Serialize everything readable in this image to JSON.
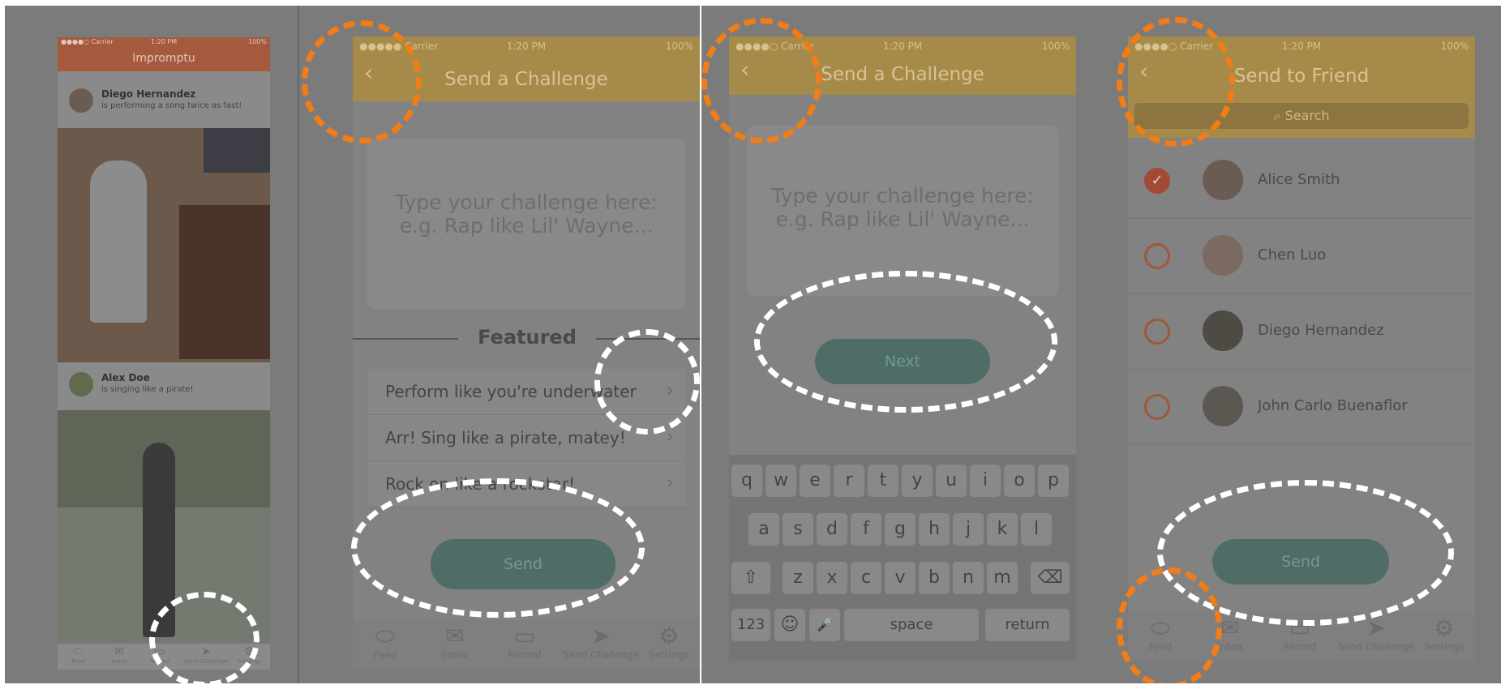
{
  "colors": {
    "ring_orange": "#f07d17",
    "ring_white": "#ffffff",
    "overlay_gray": "#7b7b7b",
    "accent_yellow": "#a58a4a",
    "accent_red": "#a14a34",
    "accent_teal": "#4f6d66"
  },
  "screen1": {
    "status": {
      "left": "●●●●○ Carrier",
      "center": "1:20 PM",
      "right": "100%"
    },
    "title": "Impromptu",
    "posts": [
      {
        "name": "Diego Hernandez",
        "caption": "is performing a song twice as fast!"
      },
      {
        "name": "Alex Doe",
        "caption": "is singing like a pirate!"
      }
    ],
    "tabs": [
      "Feed",
      "Inbox",
      "Record",
      "Send Challenge",
      "Settings"
    ]
  },
  "screen2": {
    "status": {
      "left": "●●●●● Carrier",
      "center": "1:20 PM",
      "right": "100%"
    },
    "back_icon": "‹",
    "title": "Send a Challenge",
    "placeholder_line1": "Type your challenge here:",
    "placeholder_line2": "e.g. Rap like Lil' Wayne...",
    "featured_label": "Featured",
    "featured": [
      "Perform like you're underwater",
      "Arr! Sing like a pirate, matey!",
      "Rock on like a rockstar!"
    ],
    "button": "Send",
    "tabs": [
      "Feed",
      "Inbox",
      "Record",
      "Send Challenge",
      "Settings"
    ]
  },
  "screen3": {
    "status": {
      "left": "●●●●○ Carrier",
      "center": "1:20 PM",
      "right": "100%"
    },
    "back_icon": "‹",
    "title": "Send a Challenge",
    "placeholder_line1": "Type your challenge here:",
    "placeholder_line2": "e.g. Rap like Lil' Wayne...",
    "button": "Next",
    "keys_row1": [
      "q",
      "w",
      "e",
      "r",
      "t",
      "y",
      "u",
      "i",
      "o",
      "p"
    ],
    "keys_row2": [
      "a",
      "s",
      "d",
      "f",
      "g",
      "h",
      "j",
      "k",
      "l"
    ],
    "keys_row3": [
      "z",
      "x",
      "c",
      "v",
      "b",
      "n",
      "m"
    ],
    "key_shift": "⇧",
    "key_delete": "⌫",
    "key_123": "123",
    "key_emoji": "☺",
    "key_mic": "🎤",
    "key_space": "space",
    "key_return": "return"
  },
  "screen4": {
    "status": {
      "left": "●●●●○ Carrier",
      "center": "1:20 PM",
      "right": "100%"
    },
    "back_icon": "‹",
    "title": "Send to Friend",
    "search_placeholder": "Search",
    "friends": [
      {
        "name": "Alice Smith",
        "selected": true
      },
      {
        "name": "Chen Luo",
        "selected": false
      },
      {
        "name": "Diego Hernandez",
        "selected": false
      },
      {
        "name": "John Carlo Buenaflor",
        "selected": false
      }
    ],
    "button": "Send",
    "tabs": [
      "Feed",
      "Inbox",
      "Record",
      "Send Challenge",
      "Settings"
    ]
  }
}
